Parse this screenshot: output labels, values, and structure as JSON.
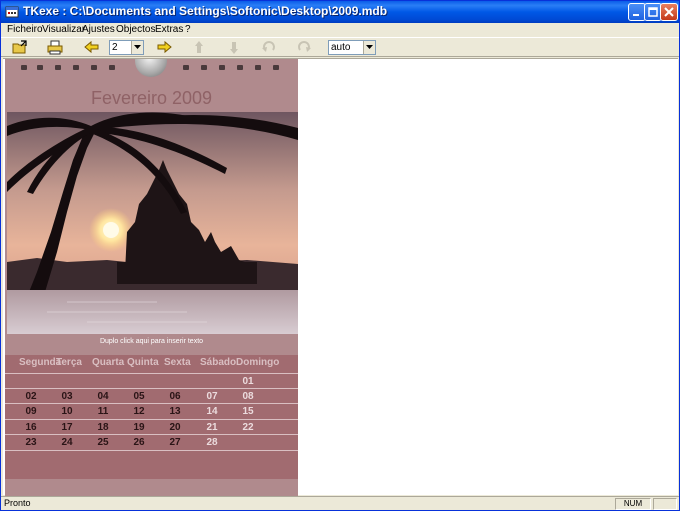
{
  "window": {
    "title": "TKexe : C:\\Documents and Settings\\Softonic\\Desktop\\2009.mdb"
  },
  "menu": [
    "Ficheiro",
    "Visualizar",
    "Ajustes",
    "Objectos",
    "Extras",
    "?"
  ],
  "toolbar": {
    "page_value": "2",
    "zoom_value": "auto",
    "icons": [
      "open-icon",
      "print-icon",
      "arrow-left-icon",
      "arrow-right-icon",
      "arrow-up-icon",
      "arrow-down-icon",
      "undo-icon",
      "redo-icon"
    ]
  },
  "calendar": {
    "month_title": "Fevereiro 2009",
    "caption": "Duplo click aqui para inserir texto",
    "day_headers": [
      "Segunda",
      "Terça",
      "Quarta",
      "Quinta",
      "Sexta",
      "Sábado",
      "Domingo"
    ],
    "weeks": [
      [
        "",
        "",
        "",
        "",
        "",
        "",
        "01"
      ],
      [
        "02",
        "03",
        "04",
        "05",
        "06",
        "07",
        "08"
      ],
      [
        "09",
        "10",
        "11",
        "12",
        "13",
        "14",
        "15"
      ],
      [
        "16",
        "17",
        "18",
        "19",
        "20",
        "21",
        "22"
      ],
      [
        "23",
        "24",
        "25",
        "26",
        "27",
        "28",
        ""
      ]
    ]
  },
  "statusbar": {
    "status": "Pronto",
    "num": "NUM"
  },
  "colors": {
    "calendar_bg": "#b08a8d",
    "grid_bg": "#a16b70",
    "month_title": "#8f6266",
    "title_bar": "#0058e6"
  }
}
